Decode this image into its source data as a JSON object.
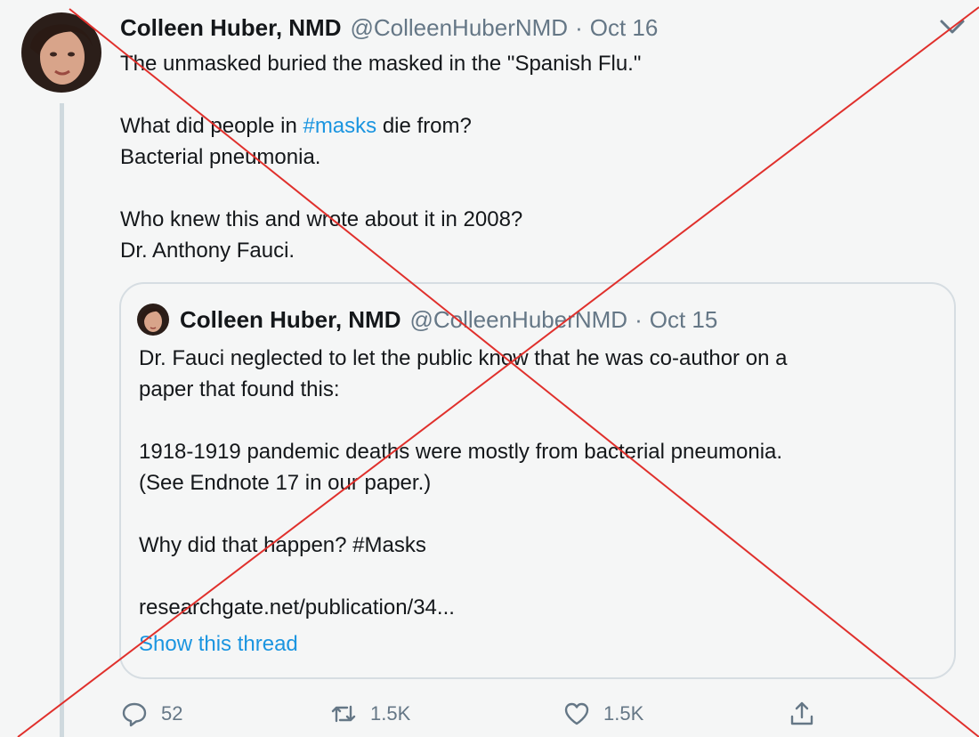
{
  "tweet": {
    "author_name": "Colleen Huber, NMD",
    "handle": "@ColleenHuberNMD",
    "separator": "·",
    "date": "Oct 16",
    "line1": "The unmasked buried the masked in the \"Spanish Flu.\"",
    "line2_before": "What did people in ",
    "line2_hashtag": "#masks",
    "line2_after": " die from?",
    "line3": "Bacterial pneumonia.",
    "line4": "Who knew this and wrote about it in 2008?",
    "line5": "Dr. Anthony Fauci."
  },
  "quote": {
    "author_name": "Colleen Huber, NMD",
    "handle": "@ColleenHuberNMD",
    "separator": "·",
    "date": "Oct 15",
    "line1": "Dr. Fauci neglected to let the public know that he was co-author on a",
    "line2": "paper that found this:",
    "line3": "1918-1919 pandemic deaths were mostly from bacterial pneumonia.",
    "line4": "(See Endnote 17 in our paper.)",
    "line5": "Why did that happen?  #Masks",
    "line6": "researchgate.net/publication/34...",
    "show_thread": "Show this thread"
  },
  "actions": {
    "replies": "52",
    "retweets": "1.5K",
    "likes": "1.5K"
  },
  "icons": {
    "reply": "speech-bubble-icon",
    "retweet": "retweet-arrows-icon",
    "like": "heart-icon",
    "share": "share-upload-icon",
    "menu": "chevron-down-icon"
  },
  "colors": {
    "link": "#1b95e0",
    "secondary_text": "#657786",
    "cross_mark": "#e0302c"
  }
}
